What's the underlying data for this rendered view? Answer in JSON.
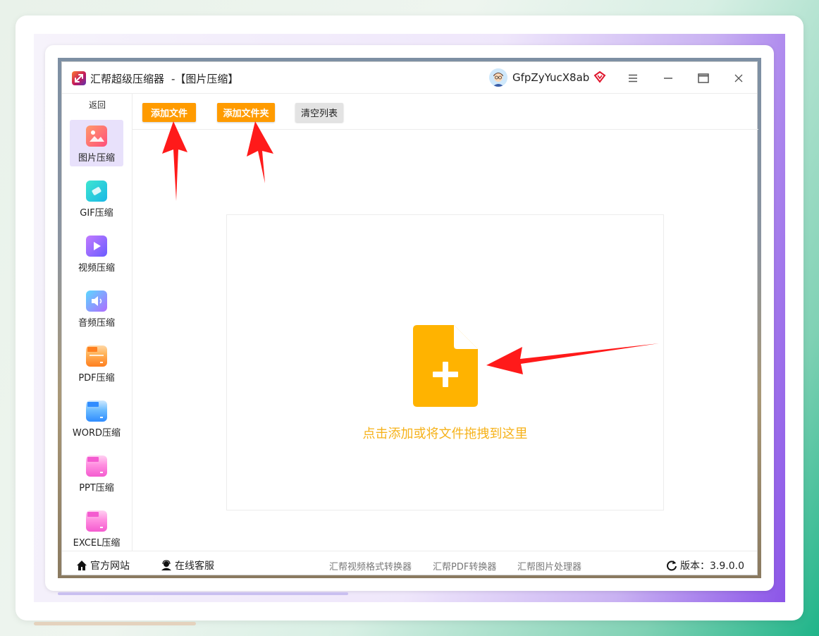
{
  "app": {
    "title": "汇帮超级压缩器",
    "section": "-【图片压缩】",
    "username": "GfpZyYucX8ab"
  },
  "window_controls": {
    "menu_icon": "hamburger-icon",
    "minimize_icon": "minimize-icon",
    "maximize_icon": "maximize-icon",
    "close_icon": "close-icon"
  },
  "sidebar": {
    "back": "返回",
    "items": [
      {
        "label": "图片压缩",
        "icon": "image-compress-icon",
        "active": true
      },
      {
        "label": "GIF压缩",
        "icon": "gif-compress-icon",
        "active": false
      },
      {
        "label": "视频压缩",
        "icon": "video-compress-icon",
        "active": false
      },
      {
        "label": "音频压缩",
        "icon": "audio-compress-icon",
        "active": false
      },
      {
        "label": "PDF压缩",
        "icon": "pdf-compress-icon",
        "active": false
      },
      {
        "label": "WORD压缩",
        "icon": "word-compress-icon",
        "active": false
      },
      {
        "label": "PPT压缩",
        "icon": "ppt-compress-icon",
        "active": false
      },
      {
        "label": "EXCEL压缩",
        "icon": "excel-compress-icon",
        "active": false
      }
    ]
  },
  "toolbar": {
    "add_file": "添加文件",
    "add_folder": "添加文件夹",
    "clear_list": "清空列表"
  },
  "dropzone": {
    "text": "点击添加或将文件拖拽到这里",
    "icon": "add-file-icon"
  },
  "statusbar": {
    "website": "官方网站",
    "support": "在线客服",
    "link1": "汇帮视频格式转换器",
    "link2": "汇帮PDF转换器",
    "link3": "汇帮图片处理器",
    "version": "版本：3.9.0.0"
  },
  "colors": {
    "accent_orange": "#ff9b00",
    "drop_yellow": "#f6b21a",
    "sidebar_active": "#e8e1fb",
    "arrow_red": "#ff1a1a"
  }
}
